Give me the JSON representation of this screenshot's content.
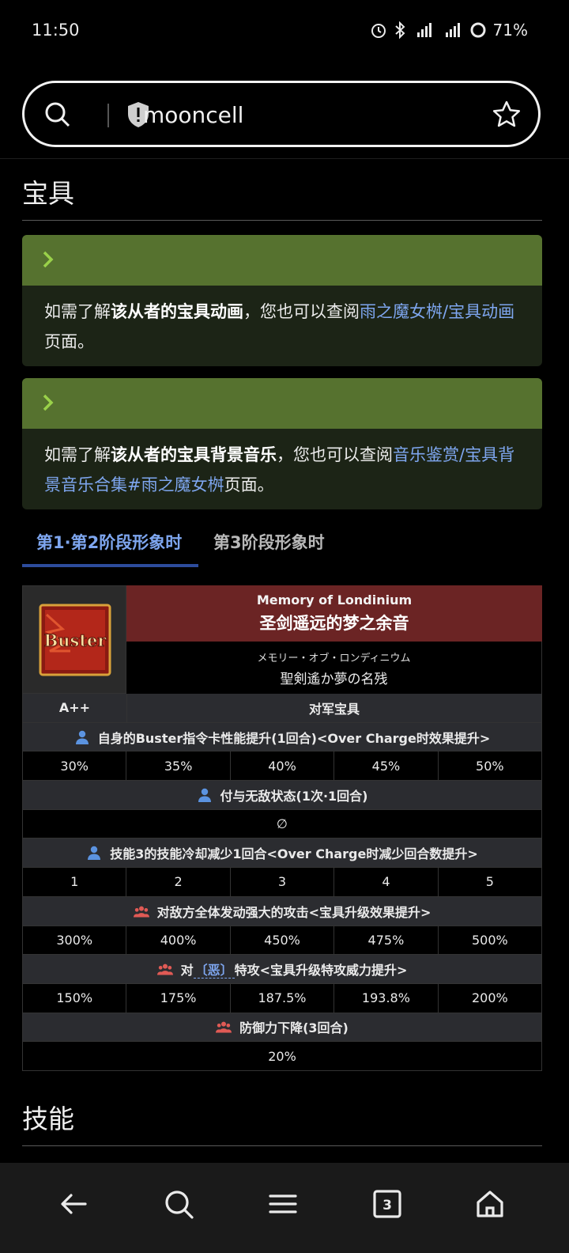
{
  "status": {
    "time": "11:50",
    "battery": "71%"
  },
  "url": {
    "text": "mooncell"
  },
  "sections": {
    "np_title": "宝具",
    "skills_title": "技能"
  },
  "notices": [
    {
      "prefix": "如需了解",
      "bold": "该从者的宝具动画",
      "middle": "，您也可以查阅",
      "link": "雨之魔女桝/宝具动画",
      "suffix": "页面。"
    },
    {
      "prefix": "如需了解",
      "bold": "该从者的宝具背景音乐",
      "middle": "，您也可以查阅",
      "link": "音乐鉴赏/宝具背景音乐合集#雨之魔女桝",
      "suffix": "页面。"
    }
  ],
  "tabs": {
    "active": "第1·第2阶段形象时",
    "inactive": "第3阶段形象时"
  },
  "np": {
    "card": "Buster",
    "name_en": "Memory of Londinium",
    "name_cn": "圣剑遥远的梦之余音",
    "name_ruby": "メモリー・オブ・ロンディニウム",
    "name_jp": "聖剣遙か夢の名残",
    "rank": "A++",
    "type": "对军宝具",
    "effects": [
      {
        "icon": "person-icon",
        "label": "自身的Buster指令卡性能提升(1回合)<Over Charge时效果提升>",
        "values": [
          "30%",
          "35%",
          "40%",
          "45%",
          "50%"
        ]
      },
      {
        "icon": "person-icon",
        "label": "付与无敌状态(1次·1回合)",
        "values": [
          "∅"
        ]
      },
      {
        "icon": "person-icon",
        "label": "技能3的技能冷却减少1回合<Over Charge时减少回合数提升>",
        "values": [
          "1",
          "2",
          "3",
          "4",
          "5"
        ]
      },
      {
        "icon": "group-icon",
        "label": "对敌方全体发动强大的攻击<宝具升级效果提升>",
        "values": [
          "300%",
          "400%",
          "450%",
          "475%",
          "500%"
        ]
      },
      {
        "icon": "group-icon",
        "label_pre": "对",
        "trait": "〔恶〕",
        "label_post": "特攻<宝具升级特攻威力提升>",
        "values": [
          "150%",
          "175%",
          "187.5%",
          "193.8%",
          "200%"
        ]
      },
      {
        "icon": "group-icon",
        "label": "防御力下降(3回合)",
        "values": [
          "20%"
        ]
      }
    ]
  },
  "nav": {
    "tab_count": "3"
  }
}
